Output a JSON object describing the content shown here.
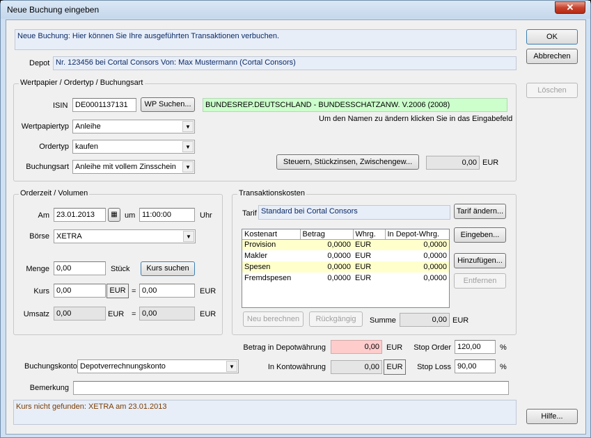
{
  "window": {
    "title": "Neue Buchung eingeben",
    "close_glyph": "✕"
  },
  "info_message": "Neue Buchung: Hier können Sie Ihre ausgeführten Transaktionen verbuchen.",
  "depot": {
    "label": "Depot",
    "value": "Nr. 123456 bei Cortal Consors  Von: Max Mustermann (Cortal Consors)"
  },
  "buttons": {
    "ok": "OK",
    "cancel": "Abbrechen",
    "delete": "Löschen",
    "help": "Hilfe..."
  },
  "security_group": {
    "title": "Wertpapier / Ordertyp / Buchungsart",
    "isin_label": "ISIN",
    "isin_value": "DE0001137131",
    "search_button": "WP Suchen...",
    "name_value": "BUNDESREP.DEUTSCHLAND - BUNDESSCHATZANW. V.2006 (2008)",
    "name_hint": "Um den Namen zu ändern klicken Sie in das Eingabefeld",
    "type_label": "Wertpapiertyp",
    "type_value": "Anleihe",
    "ordertype_label": "Ordertyp",
    "ordertype_value": "kaufen",
    "booking_label": "Buchungsart",
    "booking_value": "Anleihe mit vollem Zinsschein",
    "taxes_button": "Steuern, Stückzinsen, Zwischengew...",
    "taxes_value": "0,00",
    "taxes_currency": "EUR"
  },
  "order_group": {
    "title": "Orderzeit / Volumen",
    "date_label": "Am",
    "date_value": "23.01.2013",
    "at_label": "um",
    "time_value": "11:00:00",
    "time_unit": "Uhr",
    "exchange_label": "Börse",
    "exchange_value": "XETRA",
    "quantity_label": "Menge",
    "quantity_value": "0,00",
    "quantity_unit": "Stück",
    "price_search_button": "Kurs suchen",
    "price_label": "Kurs",
    "price_value": "0,00",
    "price_currency": "EUR",
    "equals": "=",
    "price_converted": "0,00",
    "price_converted_currency": "EUR",
    "turnover_label": "Umsatz",
    "turnover_value": "0,00",
    "turnover_currency": "EUR",
    "turnover_converted": "0,00",
    "turnover_converted_currency": "EUR"
  },
  "costs_group": {
    "title": "Transaktionskosten",
    "tariff_label": "Tarif",
    "tariff_value": "Standard bei Cortal Consors",
    "tariff_button": "Tarif ändern...",
    "columns": [
      "Kostenart",
      "Betrag",
      "Whrg.",
      "In Depot-Whrg."
    ],
    "rows": [
      {
        "type": "Provision",
        "amount": "0,0000",
        "currency": "EUR",
        "depot_amount": "0,0000"
      },
      {
        "type": "Makler",
        "amount": "0,0000",
        "currency": "EUR",
        "depot_amount": "0,0000"
      },
      {
        "type": "Spesen",
        "amount": "0,0000",
        "currency": "EUR",
        "depot_amount": "0,0000"
      },
      {
        "type": "Fremdspesen",
        "amount": "0,0000",
        "currency": "EUR",
        "depot_amount": "0,0000"
      }
    ],
    "recalc_button": "Neu berechnen",
    "undo_button": "Rückgängig",
    "sum_label": "Summe",
    "sum_value": "0,00",
    "sum_currency": "EUR",
    "enter_button": "Eingeben...",
    "add_button": "Hinzufügen...",
    "remove_button": "Entfernen"
  },
  "summary": {
    "depot_amount_label": "Betrag in Depotwährung",
    "depot_amount_value": "0,00",
    "depot_amount_currency": "EUR",
    "account_amount_label": "In Kontowährung",
    "account_amount_value": "0,00",
    "account_amount_currency": "EUR",
    "stop_order_label": "Stop Order",
    "stop_order_value": "120,00",
    "stop_order_unit": "%",
    "stop_loss_label": "Stop Loss",
    "stop_loss_value": "90,00",
    "stop_loss_unit": "%",
    "account_label": "Buchungskonto",
    "account_value": "Depotverrechnungskonto",
    "remark_label": "Bemerkung",
    "remark_value": ""
  },
  "status_message": "Kurs nicht gefunden: XETRA am 23.01.2013",
  "colors": {
    "name_field": "#ccffcc",
    "highlight_row": "#ffffcc",
    "depot_amount_field": "#ffcccc",
    "info_text": "#0a2a66",
    "status_text": "#7a3c00"
  },
  "icons": {
    "dropdown": "chevron-down-icon",
    "calendar": "calendar-icon"
  }
}
